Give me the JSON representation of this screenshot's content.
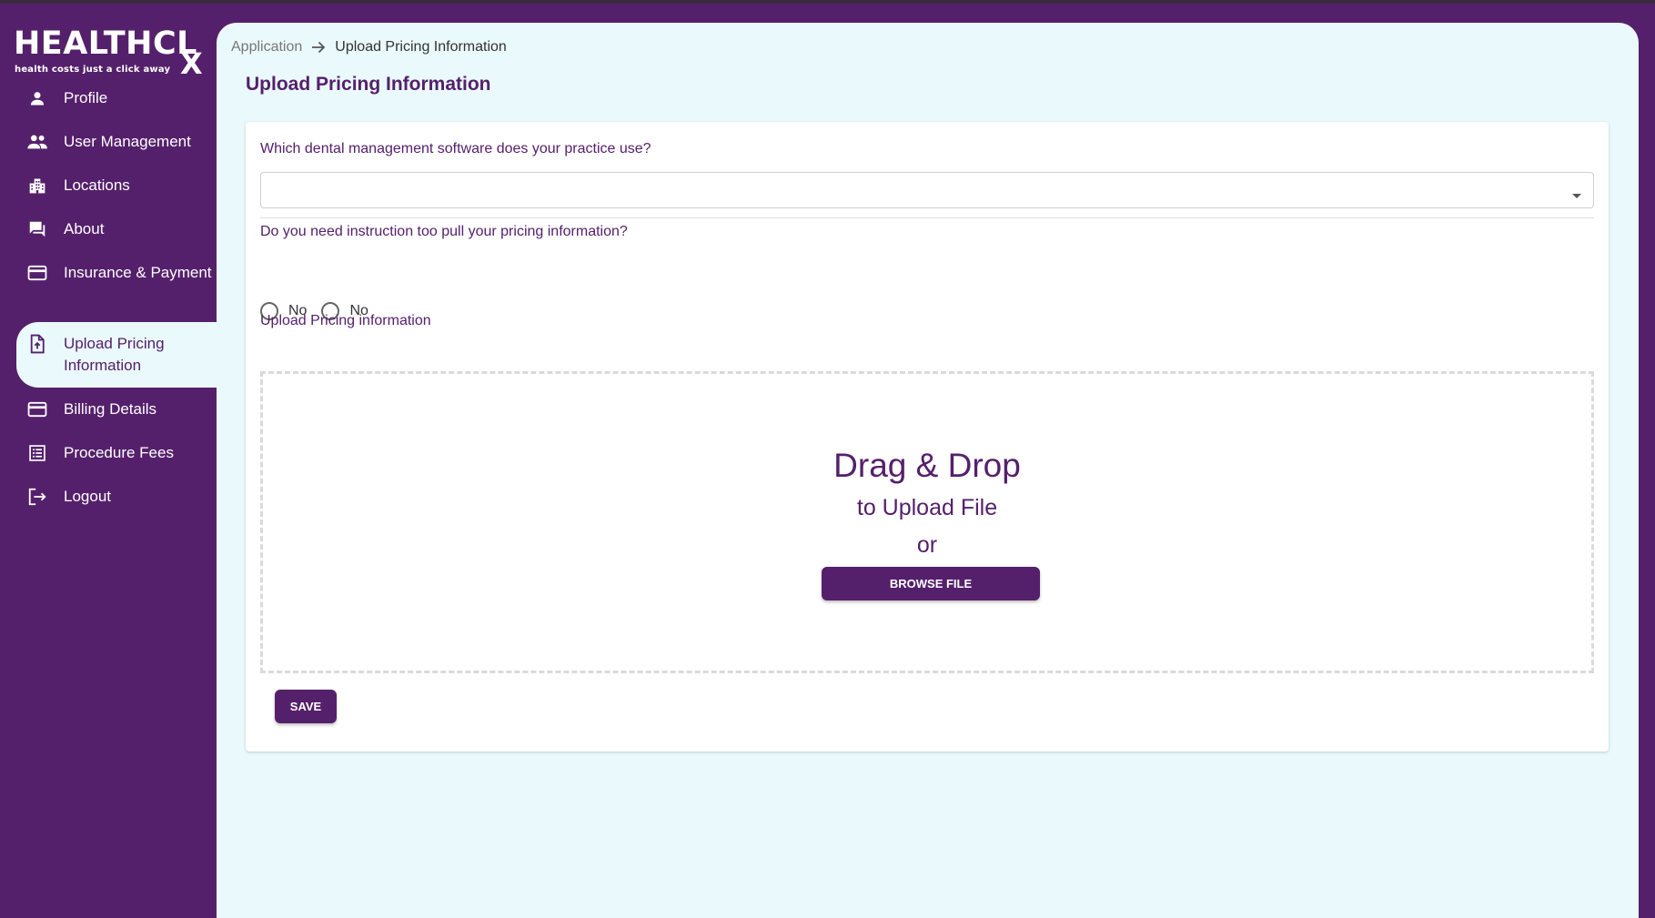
{
  "brand": {
    "logo_text": "HEALTHCL",
    "logo_suffix": "X",
    "tagline": "health costs just a click away"
  },
  "sidebar": {
    "items": [
      {
        "label": "Profile",
        "icon": "person-icon"
      },
      {
        "label": "User Management",
        "icon": "people-icon"
      },
      {
        "label": "Locations",
        "icon": "building-icon"
      },
      {
        "label": "About",
        "icon": "chat-icon"
      },
      {
        "label": "Insurance & Payment",
        "icon": "credit-card-icon"
      },
      {
        "label": "Upload Pricing Information",
        "icon": "file-upload-icon",
        "active": true
      },
      {
        "label": "Billing Details",
        "icon": "credit-card-icon"
      },
      {
        "label": "Procedure Fees",
        "icon": "list-alt-icon"
      },
      {
        "label": "Logout",
        "icon": "logout-icon"
      }
    ]
  },
  "breadcrumb": {
    "root": "Application",
    "current": "Upload Pricing Information"
  },
  "page": {
    "title": "Upload Pricing Information"
  },
  "form": {
    "software_question": "Which dental management software does your practice use?",
    "software_value": "",
    "instruction_question": "Do you need instruction too pull your pricing information?",
    "radio_options": [
      "No",
      "No"
    ],
    "upload_label": "Upload Pricing information",
    "dropzone": {
      "title": "Drag & Drop",
      "subtitle": "to Upload File",
      "or": "or",
      "browse_label": "BROWSE FILE"
    },
    "save_label": "SAVE"
  },
  "colors": {
    "primary": "#55206b",
    "panel_bg": "#eaf9fc",
    "card_bg": "#ffffff"
  }
}
